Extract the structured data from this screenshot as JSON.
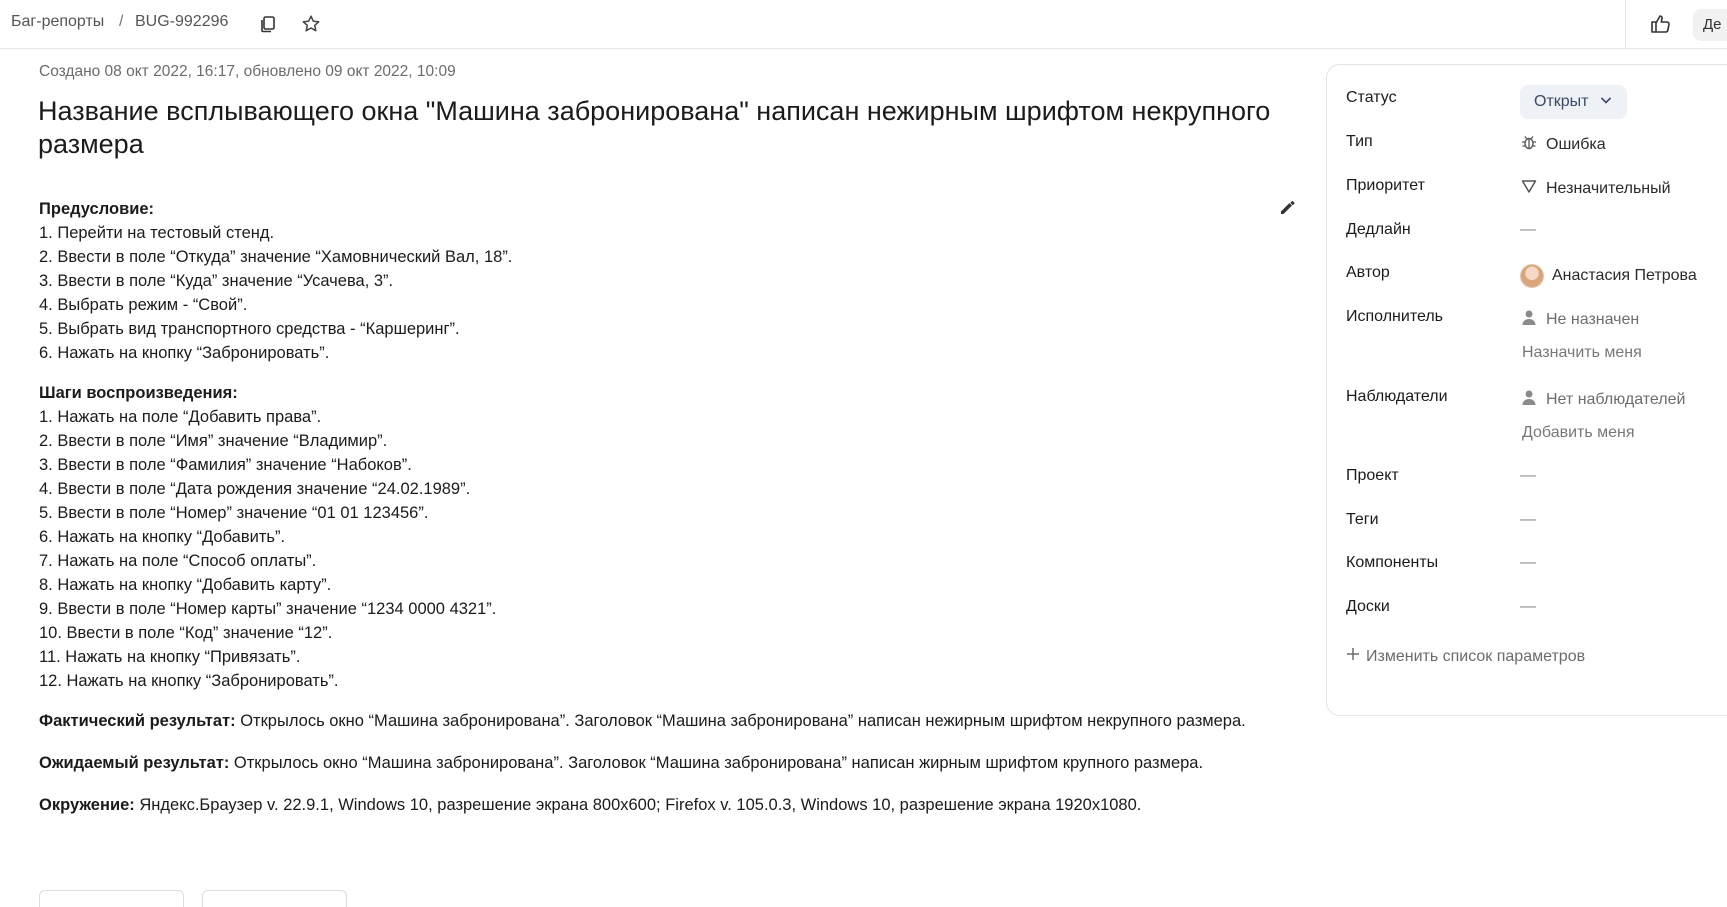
{
  "breadcrumb": {
    "root": "Баг-репорты",
    "separator": "/",
    "issue_id": "BUG-992296"
  },
  "toolbar": {
    "action_label": "Де",
    "icons": [
      "copy-icon",
      "star-icon",
      "thumbs-up-icon"
    ]
  },
  "issue": {
    "meta": "Создано 08 окт 2022, 16:17, обновлено 09 окт 2022, 10:09",
    "title": "Название всплывающего окна \"Машина забронирована\" написан нежирным шрифтом некрупного размера",
    "precondition": {
      "heading": "Предусловие:",
      "items": [
        "1. Перейти на тестовый стенд.",
        "2. Ввести в поле “Откуда” значение “Хамовнический Вал, 18”.",
        "3. Ввести в поле “Куда” значение “Усачева, 3”.",
        "4. Выбрать режим - “Свой”.",
        "5. Выбрать вид транспортного средства - “Каршеринг”.",
        "6. Нажать на кнопку “Забронировать”."
      ]
    },
    "steps": {
      "heading": "Шаги воспроизведения:",
      "items": [
        "1. Нажать на поле “Добавить права”.",
        "2. Ввести в поле “Имя” значение “Владимир”.",
        "3. Ввести в поле “Фамилия” значение “Набоков”.",
        "4. Ввести в поле “Дата рождения значение “24.02.1989”.",
        "5. Ввести в поле “Номер” значение “01 01 123456”.",
        "6. Нажать на кнопку “Добавить”.",
        "7. Нажать на поле “Способ оплаты”.",
        "8. Нажать на кнопку “Добавить карту”.",
        "9. Ввести в поле “Номер карты” значение “1234 0000 4321”.",
        "10. Ввести в поле “Код” значение “12”.",
        "11. Нажать на кнопку “Привязать”.",
        "12. Нажать на кнопку “Забронировать”."
      ]
    },
    "actual": {
      "label": "Фактический результат:",
      "text": " Открылось окно “Машина забронирована”. Заголовок “Машина забронирована” написан нежирным шрифтом некрупного размера."
    },
    "expected": {
      "label": "Ожидаемый результат:",
      "text": " Открылось окно “Машина забронирована”. Заголовок “Машина забронирована” написан жирным шрифтом крупного размера."
    },
    "environment": {
      "label": "Окружение:",
      "text": " Яндекс.Браузер v. 22.9.1, Windows 10, разрешение экрана 800x600; Firefox v. 105.0.3, Windows 10, разрешение экрана 1920x1080."
    }
  },
  "sidebar": {
    "status": {
      "label": "Статус",
      "value": "Открыт"
    },
    "type": {
      "label": "Тип",
      "value": "Ошибка"
    },
    "priority": {
      "label": "Приоритет",
      "value": "Незначительный"
    },
    "deadline": {
      "label": "Дедлайн",
      "value": "—"
    },
    "author": {
      "label": "Автор",
      "value": "Анастасия Петрова"
    },
    "assignee": {
      "label": "Исполнитель",
      "value": "Не назначен",
      "action": "Назначить меня"
    },
    "watchers": {
      "label": "Наблюдатели",
      "value": "Нет наблюдателей",
      "action": "Добавить меня"
    },
    "project": {
      "label": "Проект",
      "value": "—"
    },
    "tags": {
      "label": "Теги",
      "value": "—"
    },
    "components": {
      "label": "Компоненты",
      "value": "—"
    },
    "boards": {
      "label": "Доски",
      "value": "—"
    },
    "edit_params": "Изменить список параметров"
  }
}
